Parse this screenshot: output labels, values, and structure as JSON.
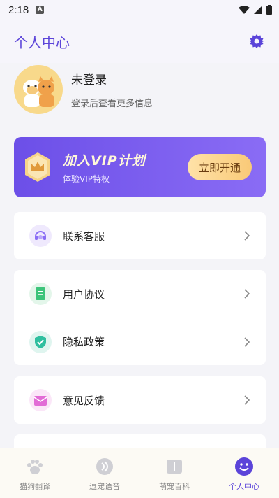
{
  "status_bar": {
    "time": "2:18",
    "notification_badge": "A"
  },
  "header": {
    "title": "个人中心",
    "settings_icon": "gear-icon"
  },
  "profile": {
    "name": "未登录",
    "subtitle": "登录后查看更多信息"
  },
  "vip": {
    "title": "加入VIP计划",
    "subtitle": "体验VIP特权",
    "button": "立即开通"
  },
  "menu": [
    {
      "label": "联系客服",
      "icon": "headset-icon",
      "color": "#8a6cf5"
    },
    {
      "label": "用户协议",
      "icon": "document-icon",
      "color": "#3cc47a"
    },
    {
      "label": "隐私政策",
      "icon": "shield-icon",
      "color": "#2fbf9f"
    },
    {
      "label": "意见反馈",
      "icon": "mail-icon",
      "color": "#e26bd6"
    }
  ],
  "tabs": [
    {
      "label": "猫狗翻译",
      "icon": "paw-icon"
    },
    {
      "label": "逗宠语音",
      "icon": "voice-icon"
    },
    {
      "label": "萌宠百科",
      "icon": "book-icon"
    },
    {
      "label": "个人中心",
      "icon": "smile-icon",
      "active": true
    }
  ],
  "colors": {
    "accent": "#5b44d9",
    "vip_gradient_start": "#6c4fe8",
    "vip_gradient_end": "#8a6cf5"
  }
}
